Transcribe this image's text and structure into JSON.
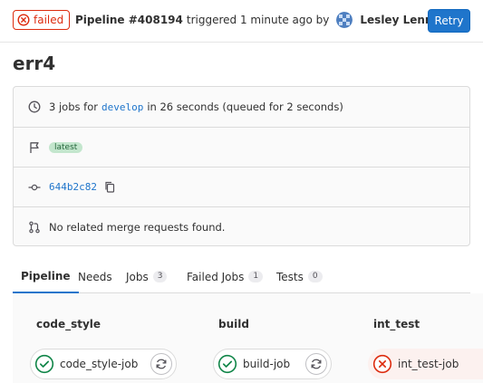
{
  "header": {
    "status": "failed",
    "pipeline_id": "Pipeline #408194",
    "triggered_text": "triggered 1 minute ago by",
    "user_name": "Lesley Lennie",
    "retry_label": "Retry"
  },
  "title": "err4",
  "info": {
    "jobs_prefix": "3 jobs for",
    "branch": "develop",
    "jobs_suffix": "in 26 seconds (queued for 2 seconds)",
    "latest_badge": "latest",
    "commit_sha": "644b2c82",
    "merge_requests": "No related merge requests found."
  },
  "tabs": [
    {
      "label": "Pipeline",
      "active": true
    },
    {
      "label": "Needs"
    },
    {
      "label": "Jobs",
      "count": "3"
    },
    {
      "label": "Failed Jobs",
      "count": "1"
    },
    {
      "label": "Tests",
      "count": "0"
    }
  ],
  "stages": [
    {
      "title": "code_style",
      "job": "code_style-job",
      "status": "success"
    },
    {
      "title": "build",
      "job": "build-job",
      "status": "success"
    },
    {
      "title": "int_test",
      "job": "int_test-job",
      "status": "failed"
    }
  ],
  "colors": {
    "failed": "#dd2b0e",
    "success": "#108548",
    "primary": "#1f75cb"
  },
  "icons": {
    "status": "close-circle-icon",
    "clock": "clock-icon",
    "flag": "flag-icon",
    "commit": "commit-icon",
    "copy": "copy-icon",
    "merge_request": "merge-request-icon",
    "success": "check-circle-icon",
    "retry": "retry-icon"
  }
}
